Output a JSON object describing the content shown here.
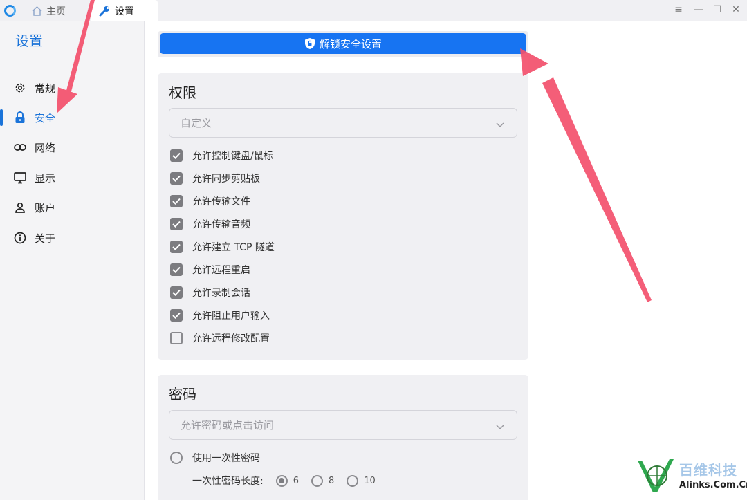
{
  "titlebar": {
    "tabs": [
      {
        "label": "主页",
        "icon": "home-icon"
      },
      {
        "label": "设置",
        "icon": "wrench-icon"
      }
    ],
    "controls": [
      "menu-icon",
      "minimize-icon",
      "maximize-icon",
      "close-icon"
    ]
  },
  "sidebar": {
    "title": "设置",
    "items": [
      {
        "label": "常规",
        "icon": "gear-icon",
        "active": false
      },
      {
        "label": "安全",
        "icon": "lock-icon",
        "active": true
      },
      {
        "label": "网络",
        "icon": "link-icon",
        "active": false
      },
      {
        "label": "显示",
        "icon": "monitor-icon",
        "active": false
      },
      {
        "label": "账户",
        "icon": "user-icon",
        "active": false
      },
      {
        "label": "关于",
        "icon": "info-icon",
        "active": false
      }
    ]
  },
  "unlock": {
    "label": "解锁安全设置",
    "icon": "shield-icon"
  },
  "permissions": {
    "title": "权限",
    "select_value": "自定义",
    "options": [
      {
        "label": "允许控制键盘/鼠标",
        "checked": true
      },
      {
        "label": "允许同步剪贴板",
        "checked": true
      },
      {
        "label": "允许传输文件",
        "checked": true
      },
      {
        "label": "允许传输音频",
        "checked": true
      },
      {
        "label": "允许建立 TCP 隧道",
        "checked": true
      },
      {
        "label": "允许远程重启",
        "checked": true
      },
      {
        "label": "允许录制会话",
        "checked": true
      },
      {
        "label": "允许阻止用户输入",
        "checked": true
      },
      {
        "label": "允许远程修改配置",
        "checked": false
      }
    ]
  },
  "password": {
    "title": "密码",
    "select_value": "允许密码或点击访问",
    "one_time_label": "使用一次性密码",
    "one_time_checked": false,
    "length_label": "一次性密码长度:",
    "lengths": [
      {
        "label": "6",
        "selected": true
      },
      {
        "label": "8",
        "selected": false
      },
      {
        "label": "10",
        "selected": false
      }
    ]
  },
  "watermark": {
    "line1": "百维科技",
    "line2": "Alinks.Com.Cn"
  },
  "colors": {
    "accent": "#1a73d9",
    "button": "#1774f2",
    "arrow": "#f3506c"
  }
}
